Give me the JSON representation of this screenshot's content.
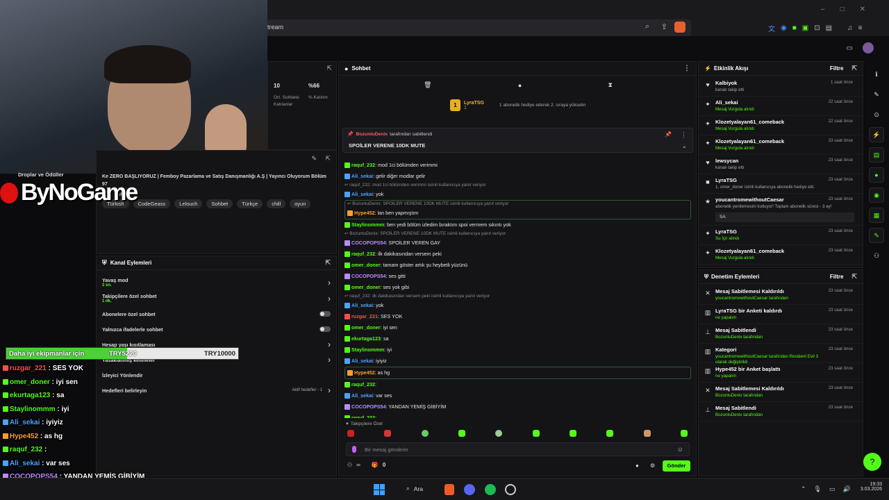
{
  "browser": {
    "url_fragment": "tream"
  },
  "stream_info": {
    "title": "Ke ZERO BAŞLIYORUZ | Femboy Pazarlama ve Satış Danışmanlığı A.Ş | Yayıncı Oluyorum Bölüm 97",
    "category": "Sohbet",
    "tags": [
      "Türkish",
      "CodeGeass",
      "Lelouch",
      "Sohbet",
      "Türkçe",
      "chill",
      "oyun"
    ],
    "stats": [
      {
        "value": "10",
        "label": "Ort. Sohbete Katılanlar"
      },
      {
        "value": "%66",
        "label": "% Katılım"
      }
    ],
    "drops_label": "Droplar ve Ödüller"
  },
  "overlay": {
    "logo": "ByNoGame",
    "donation_goal": {
      "label": "Daha iyi ekipmanlar için",
      "current": "TRY5220",
      "target": "TRY10000",
      "progress": 0.522
    },
    "chat": [
      {
        "user": "ruzgar_221",
        "text": ": SES YOK",
        "color": "#ff4d4d"
      },
      {
        "user": "omer_doner",
        "text": ": iyi sen",
        "color": "#53fc18"
      },
      {
        "user": "ekurtaga123",
        "text": ": sa",
        "color": "#53fc18"
      },
      {
        "user": "Staylinommm",
        "text": ": iyi",
        "color": "#53fc18"
      },
      {
        "user": "Ali_sekai",
        "text": ": iyiyiz",
        "color": "#4aa3ff"
      },
      {
        "user": "Hype452",
        "text": ": as hg",
        "color": "#ff9d2e"
      },
      {
        "user": "raquf_232",
        "text": ":",
        "color": "#53fc18"
      },
      {
        "user": "Ali_sekai",
        "text": ": var ses",
        "color": "#4aa3ff"
      },
      {
        "user": "COCOPOPS54",
        "text": ": YANDAN YEMİŞ GİBİYİM",
        "color": "#b98bff"
      },
      {
        "user": "raquf_232",
        "text": ":",
        "color": "#53fc18"
      }
    ]
  },
  "channel_actions": {
    "title": "Kanal Eylemleri",
    "items": [
      {
        "label": "Yavaş mod",
        "sub": "2 sn.",
        "control": "chevron"
      },
      {
        "label": "Takipçilere özel sohbet",
        "sub": "1 dk.",
        "control": "chevron"
      },
      {
        "label": "Abonelere özel sohbet",
        "sub": "",
        "control": "toggle"
      },
      {
        "label": "Yalnızca ifadelerle sohbet",
        "sub": "",
        "control": "toggle"
      },
      {
        "label": "Hesap yaşı kısıtlaması",
        "sub": "",
        "control": "chevron"
      },
      {
        "label": "Yasaklanmış kelimeler",
        "sub": "",
        "control": "chevron"
      },
      {
        "label": "İzleyici Yönlendir",
        "sub": "",
        "control": "none"
      },
      {
        "label": "Hedefleri belirleyin",
        "sub": "",
        "control": "chevron"
      }
    ],
    "goals_status": "Aktif hedefler - 1"
  },
  "chat_panel": {
    "title": "Sohbet",
    "promo": {
      "user": "LyraTSG",
      "count": "1",
      "text": "1 abonelik hediye ederek 2. sıraya yükselin"
    },
    "pinned": {
      "by": "BozuntuDenix",
      "suffix": "tarafından sabitlendi",
      "text": "SPOİLER VERENE 10DK MUTE"
    },
    "messages": [
      {
        "reply": "",
        "user": "raquf_232",
        "color": "#53fc18",
        "text": ": mod 1ci bölümden verimmi",
        "hl": false
      },
      {
        "reply": "",
        "user": "Ali_sekai",
        "color": "#4aa3ff",
        "text": ": gelir diğer modlar gelir",
        "hl": false
      },
      {
        "reply": "raquf_232: mod 1ci bölümden verimmi isimli kullanıcıya yanıt veriyor",
        "user": "Ali_sekai",
        "color": "#4aa3ff",
        "text": ": yok",
        "hl": false
      },
      {
        "reply": "BozuntuDenix: SPOİLER VERENE 10DK MUTE isimli kullanıcıya yanıt veriyor",
        "user": "Hype452",
        "color": "#ff9d2e",
        "text": ": lan ben yapmıştım",
        "hl": true
      },
      {
        "reply": "",
        "user": "Staylinommm",
        "color": "#53fc18",
        "text": ": ben yedi bölüm izledim bıraktım spoi vermem sıkıntı yok",
        "hl": false
      },
      {
        "reply": "BozuntuDenix: SPOİLER VERENE 10DK MUTE isimli kullanıcıya yanıt veriyor",
        "user": "COCOPOPS54",
        "color": "#b98bff",
        "text": ": SPOİLER VEREN GAY",
        "hl": false
      },
      {
        "reply": "",
        "user": "raquf_232",
        "color": "#53fc18",
        "text": ": ilk dakikasından versem peki",
        "hl": false
      },
      {
        "reply": "",
        "user": "omer_doner",
        "color": "#53fc18",
        "text": ": tamam göster artık şu heybetli yüzünü",
        "hl": false
      },
      {
        "reply": "",
        "user": "COCOPOPS54",
        "color": "#b98bff",
        "text": ": ses gitti",
        "hl": false
      },
      {
        "reply": "",
        "user": "omer_doner",
        "color": "#53fc18",
        "text": ": ses yok gibi",
        "hl": false
      },
      {
        "reply": "raquf_232: ilk dakikasından versem peki isimli kullanıcıya yanıt veriyor",
        "user": "Ali_sekai",
        "color": "#4aa3ff",
        "text": ": yok",
        "hl": false
      },
      {
        "reply": "",
        "user": "ruzgar_221",
        "color": "#ff4d4d",
        "text": ": SES YOK",
        "hl": false
      },
      {
        "reply": "",
        "user": "omer_doner",
        "color": "#53fc18",
        "text": ": iyi sen",
        "hl": false
      },
      {
        "reply": "",
        "user": "ekurtaga123",
        "color": "#53fc18",
        "text": ": sa",
        "hl": false
      },
      {
        "reply": "",
        "user": "Staylinommm",
        "color": "#53fc18",
        "text": ": iyi",
        "hl": false
      },
      {
        "reply": "",
        "user": "Ali_sekai",
        "color": "#4aa3ff",
        "text": ": iyiyiz",
        "hl": false
      },
      {
        "reply": "",
        "user": "Hype452",
        "color": "#ff9d2e",
        "text": ": as hg",
        "hl": true
      },
      {
        "reply": "",
        "user": "raquf_232",
        "color": "#53fc18",
        "text": ":",
        "hl": false
      },
      {
        "reply": "",
        "user": "Ali_sekai",
        "color": "#4aa3ff",
        "text": ": var ses",
        "hl": false
      },
      {
        "reply": "",
        "user": "COCOPOPS54",
        "color": "#b98bff",
        "text": ": YANDAN YEMİŞ GİBİYİM",
        "hl": false
      },
      {
        "reply": "",
        "user": "raquf_232",
        "color": "#53fc18",
        "text": ":",
        "hl": false
      }
    ],
    "followers_label": "Takipçilere Özel",
    "input_placeholder": "Bir mesaj gönderin",
    "count": "0",
    "send_label": "Gönder"
  },
  "activity": {
    "title": "Etkinlik Akışı",
    "filter": "Filtre",
    "items": [
      {
        "icon": "♥",
        "user": "Kalbiyok",
        "sub": "kanalı takip etti",
        "time": "1 saat önce"
      },
      {
        "icon": "✦",
        "user": "Ali_sekai",
        "sub": "Mesaj Vurgula alındı",
        "time": "22 saat önce"
      },
      {
        "icon": "✦",
        "user": "Klozetyalayan61_comeback",
        "sub": "Mesaj Vurgula alındı",
        "time": "22 saat önce"
      },
      {
        "icon": "✦",
        "user": "Klozetyalayan61_comeback",
        "sub": "Mesaj Vurgula alındı",
        "time": "23 saat önce"
      },
      {
        "icon": "♥",
        "user": "lewsycan",
        "sub": "kanalı takip etti",
        "time": "23 saat önce"
      },
      {
        "icon": "■",
        "user": "LyraTSG",
        "sub": "1, omer_doner isimli kullanıcıya abonelik hediye etti.",
        "time": "23 saat önce"
      },
      {
        "icon": "★",
        "user": "youcantromewithoutCaesar",
        "sub": "abonelik yenilemesini kutluyor! Toplam abonelik süresi - 3 ay!",
        "time": "23 saat önce",
        "note": "SA"
      },
      {
        "icon": "✦",
        "user": "LyraTSG",
        "sub": "Su İçir alındı",
        "time": "23 saat önce"
      },
      {
        "icon": "✦",
        "user": "Klozetyalayan61_comeback",
        "sub": "Mesaj Vurgula alındı",
        "time": "23 saat önce"
      }
    ]
  },
  "moderation": {
    "title": "Denetim Eylemleri",
    "filter": "Filtre",
    "items": [
      {
        "icon": "✕",
        "title": "Mesaj Sabitlemesi Kaldırıldı",
        "sub": "youcantromewithoutCaesar tarafından",
        "time": "23 saat önce"
      },
      {
        "icon": "▥",
        "title": "LyraTSG bir Anketi kaldırdı",
        "sub": "ne yapalım",
        "time": "23 saat önce"
      },
      {
        "icon": "⊥",
        "title": "Mesaj Sabitlendi",
        "sub": "BozuntuDenix tarafından",
        "time": "23 saat önce"
      },
      {
        "icon": "▥",
        "title": "Kategori",
        "sub": "youcantromewithoutCaesar tarafından Resident Evil 3 olarak değiştirildi",
        "time": "23 saat önce"
      },
      {
        "icon": "▥",
        "title": "Hype452 bir Anket başlattı",
        "sub": "ne yapalım",
        "time": "23 saat önce"
      },
      {
        "icon": "✕",
        "title": "Mesaj Sabitlemesi Kaldırıldı",
        "sub": "BozuntuDenix tarafından",
        "time": "23 saat önce"
      },
      {
        "icon": "⊥",
        "title": "Mesaj Sabitlendi",
        "sub": "BozuntuDenix tarafından",
        "time": "23 saat önce"
      }
    ]
  },
  "taskbar": {
    "search": "Ara",
    "time": "19:33",
    "date": "3.03.2026"
  }
}
